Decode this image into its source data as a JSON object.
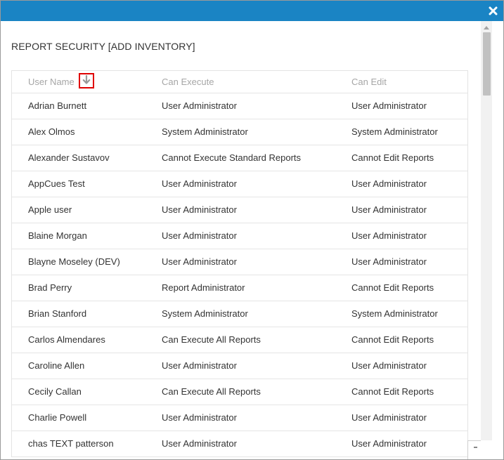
{
  "dialog": {
    "title": "REPORT SECURITY [ADD INVENTORY]"
  },
  "colors": {
    "titlebar": "#1a84c4",
    "sort_highlight": "#e00000",
    "header_text": "#a6a6a6",
    "row_divider": "#e5e5e5"
  },
  "icons": {
    "close": "close-icon",
    "sort": "arrow-down-icon",
    "scroll_up": "chevron-up-icon"
  },
  "table": {
    "columns": [
      "User Name",
      "Can Execute",
      "Can Edit"
    ],
    "sort": {
      "column": "User Name",
      "direction": "descending"
    },
    "rows": [
      [
        "Adrian Burnett",
        "User Administrator",
        "User Administrator"
      ],
      [
        "Alex Olmos",
        "System Administrator",
        "System Administrator"
      ],
      [
        "Alexander Sustavov",
        "Cannot Execute Standard Reports",
        "Cannot Edit Reports"
      ],
      [
        "AppCues Test",
        "User Administrator",
        "User Administrator"
      ],
      [
        "Apple user",
        "User Administrator",
        "User Administrator"
      ],
      [
        "Blaine Morgan",
        "User Administrator",
        "User Administrator"
      ],
      [
        "Blayne Moseley (DEV)",
        "User Administrator",
        "User Administrator"
      ],
      [
        "Brad Perry",
        "Report Administrator",
        "Cannot Edit Reports"
      ],
      [
        "Brian Stanford",
        "System Administrator",
        "System Administrator"
      ],
      [
        "Carlos Almendares",
        "Can Execute All Reports",
        "Cannot Edit Reports"
      ],
      [
        "Caroline Allen",
        "User Administrator",
        "User Administrator"
      ],
      [
        "Cecily Callan",
        "Can Execute All Reports",
        "Cannot Edit Reports"
      ],
      [
        "Charlie Powell",
        "User Administrator",
        "User Administrator"
      ],
      [
        "chas TEXT patterson",
        "User Administrator",
        "User Administrator"
      ]
    ]
  }
}
